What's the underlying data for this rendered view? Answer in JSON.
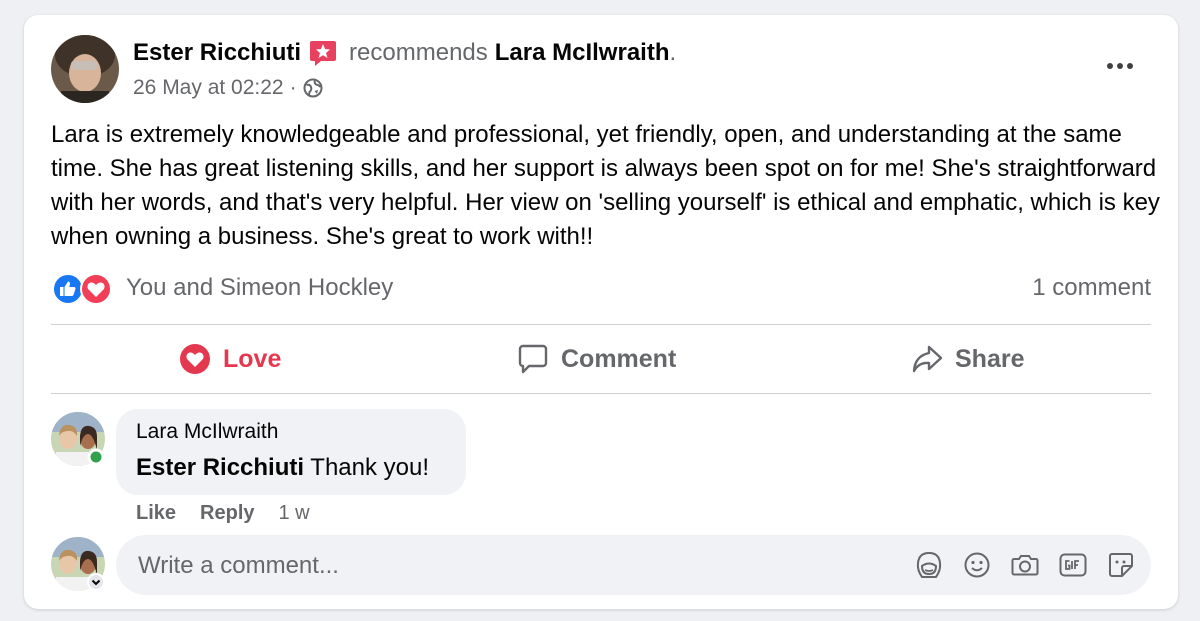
{
  "post": {
    "author": "Ester Ricchiuti",
    "action_text": "recommends",
    "target": "Lara McIlwraith",
    "target_suffix": ".",
    "timestamp": "26 May at 02:22",
    "separator": "·",
    "privacy_icon": "globe-icon",
    "more_icon": "more-options-icon",
    "body": "Lara is extremely knowledgeable and professional, yet friendly, open, and understanding at the same time. She has great listening skills, and her support is always been spot on for me! She's straightforward with her words, and that's very helpful. Her view on 'selling yourself' is ethical and emphatic, which is key when owning a business. She's great to work with!!"
  },
  "reactions": {
    "icons": [
      "like-icon",
      "love-icon"
    ],
    "text": "You and Simeon Hockley",
    "comment_count": "1 comment"
  },
  "actions": {
    "love_label": "Love",
    "comment_label": "Comment",
    "share_label": "Share"
  },
  "comments": [
    {
      "author": "Lara McIlwraith",
      "mention": "Ester Ricchiuti",
      "text": " Thank you!",
      "like_label": "Like",
      "reply_label": "Reply",
      "age": "1 w"
    }
  ],
  "composer": {
    "placeholder": "Write a comment...",
    "tools": [
      "avatar-sticker-icon",
      "emoji-icon",
      "camera-icon",
      "gif-icon",
      "sticker-icon"
    ]
  },
  "colors": {
    "love": "#e4384f",
    "like_blue": "#1877f2",
    "muted_text": "#65676b",
    "online_green": "#31a24c",
    "recommend_badge": "#e8405f"
  }
}
